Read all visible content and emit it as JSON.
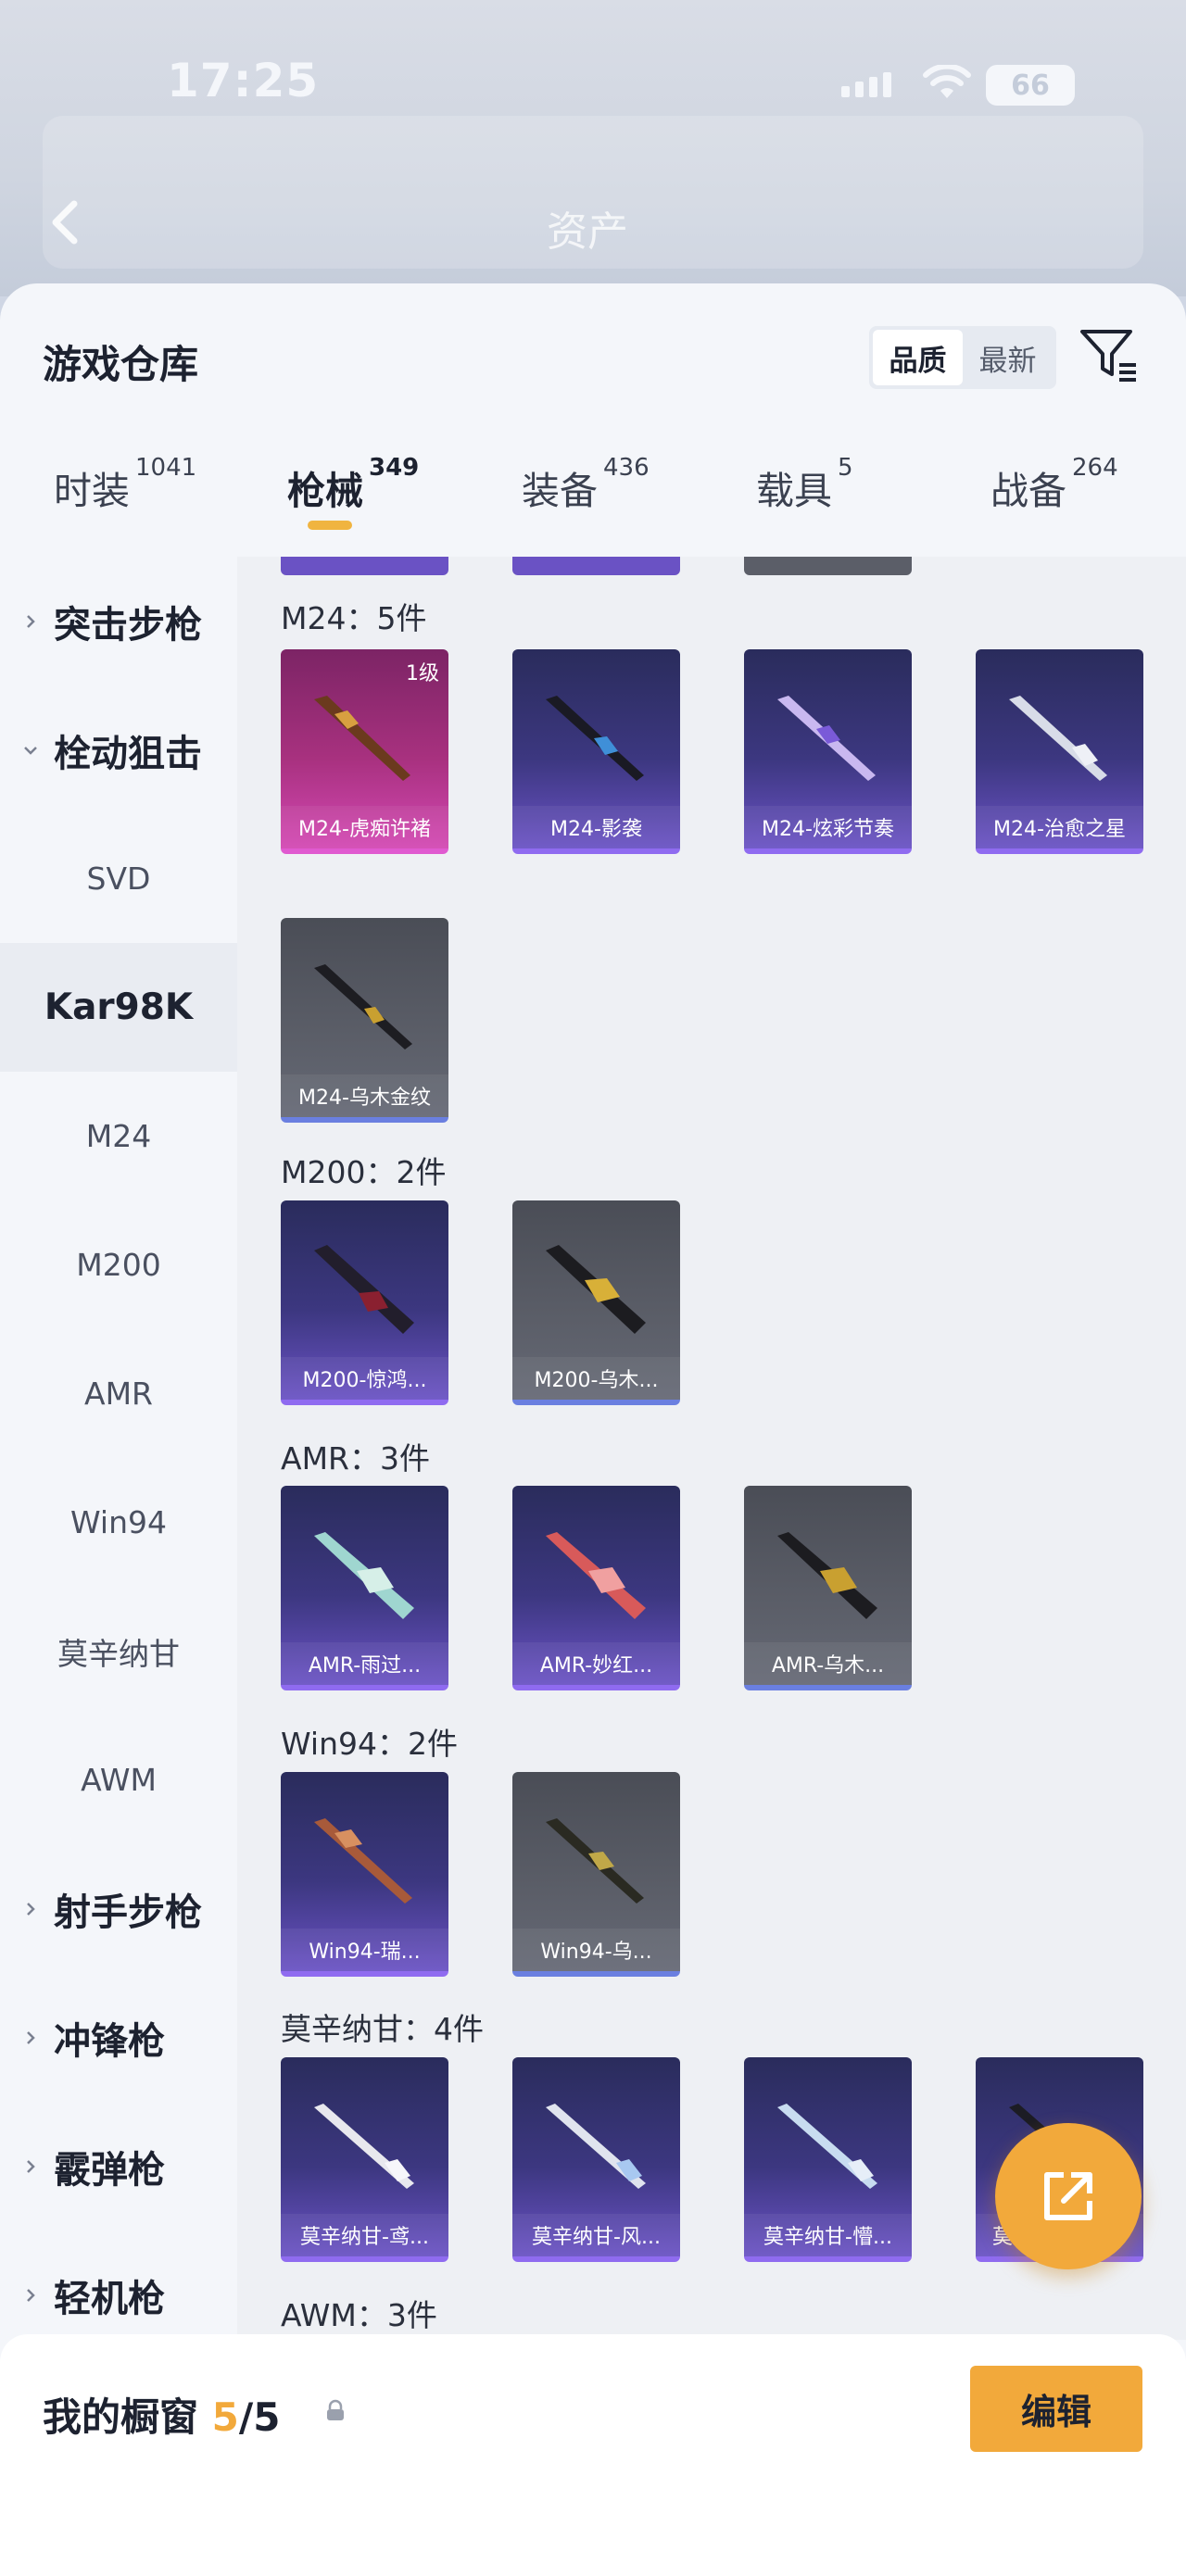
{
  "status_bar": {
    "time": "17:25",
    "battery": "66"
  },
  "background_header": {
    "active_tab": "资产"
  },
  "sheet": {
    "title": "游戏仓库",
    "sort": [
      {
        "label": "品质",
        "active": true
      },
      {
        "label": "最新",
        "active": false
      }
    ]
  },
  "tabs": [
    {
      "label": "时装",
      "count": "1041"
    },
    {
      "label": "枪械",
      "count": "349",
      "active": true
    },
    {
      "label": "装备",
      "count": "436"
    },
    {
      "label": "载具",
      "count": "5"
    },
    {
      "label": "战备",
      "count": "264"
    }
  ],
  "nav": [
    {
      "label": "突击步枪",
      "type": "group",
      "expanded": false
    },
    {
      "label": "栓动狙击",
      "type": "group",
      "expanded": true
    },
    {
      "label": "SVD",
      "type": "item"
    },
    {
      "label": "Kar98K",
      "type": "item",
      "active": true
    },
    {
      "label": "M24",
      "type": "item"
    },
    {
      "label": "M200",
      "type": "item"
    },
    {
      "label": "AMR",
      "type": "item"
    },
    {
      "label": "Win94",
      "type": "item"
    },
    {
      "label": "莫辛纳甘",
      "type": "item"
    },
    {
      "label": "AWM",
      "type": "item"
    },
    {
      "label": "射手步枪",
      "type": "group",
      "expanded": false
    },
    {
      "label": "冲锋枪",
      "type": "group",
      "expanded": false
    },
    {
      "label": "霰弹枪",
      "type": "group",
      "expanded": false
    },
    {
      "label": "轻机枪",
      "type": "group",
      "expanded": false
    }
  ],
  "sections": [
    {
      "title": "M24：5件",
      "items": [
        {
          "label": "M24-虎痴许褚",
          "rarity": "pink",
          "level": "1级"
        },
        {
          "label": "M24-影袭",
          "rarity": "purple"
        },
        {
          "label": "M24-炫彩节奏",
          "rarity": "purple"
        },
        {
          "label": "M24-治愈之星",
          "rarity": "purple"
        },
        {
          "label": "M24-乌木金纹",
          "rarity": "grey"
        }
      ]
    },
    {
      "title": "M200：2件",
      "items": [
        {
          "label": "M200-惊鸿...",
          "rarity": "purple"
        },
        {
          "label": "M200-乌木...",
          "rarity": "grey"
        }
      ]
    },
    {
      "title": "AMR：3件",
      "items": [
        {
          "label": "AMR-雨过...",
          "rarity": "purple"
        },
        {
          "label": "AMR-妙红...",
          "rarity": "purple"
        },
        {
          "label": "AMR-乌木...",
          "rarity": "grey"
        }
      ]
    },
    {
      "title": "Win94：2件",
      "items": [
        {
          "label": "Win94-瑞...",
          "rarity": "purple"
        },
        {
          "label": "Win94-乌...",
          "rarity": "grey"
        }
      ]
    },
    {
      "title": "莫辛纳甘：4件",
      "items": [
        {
          "label": "莫辛纳甘-鸢...",
          "rarity": "purple"
        },
        {
          "label": "莫辛纳甘-风...",
          "rarity": "purple"
        },
        {
          "label": "莫辛纳甘-懵...",
          "rarity": "purple"
        },
        {
          "label": "莫",
          "rarity": "purple"
        }
      ]
    },
    {
      "title": "AWM：3件",
      "items": []
    }
  ],
  "footer": {
    "title": "我的橱窗",
    "current": "5",
    "total": "/5",
    "edit_label": "编辑"
  },
  "colors": {
    "accent": "#f2a93b",
    "purple": "#3c3780",
    "pink": "#a8317f",
    "grey": "#5b5e68"
  }
}
